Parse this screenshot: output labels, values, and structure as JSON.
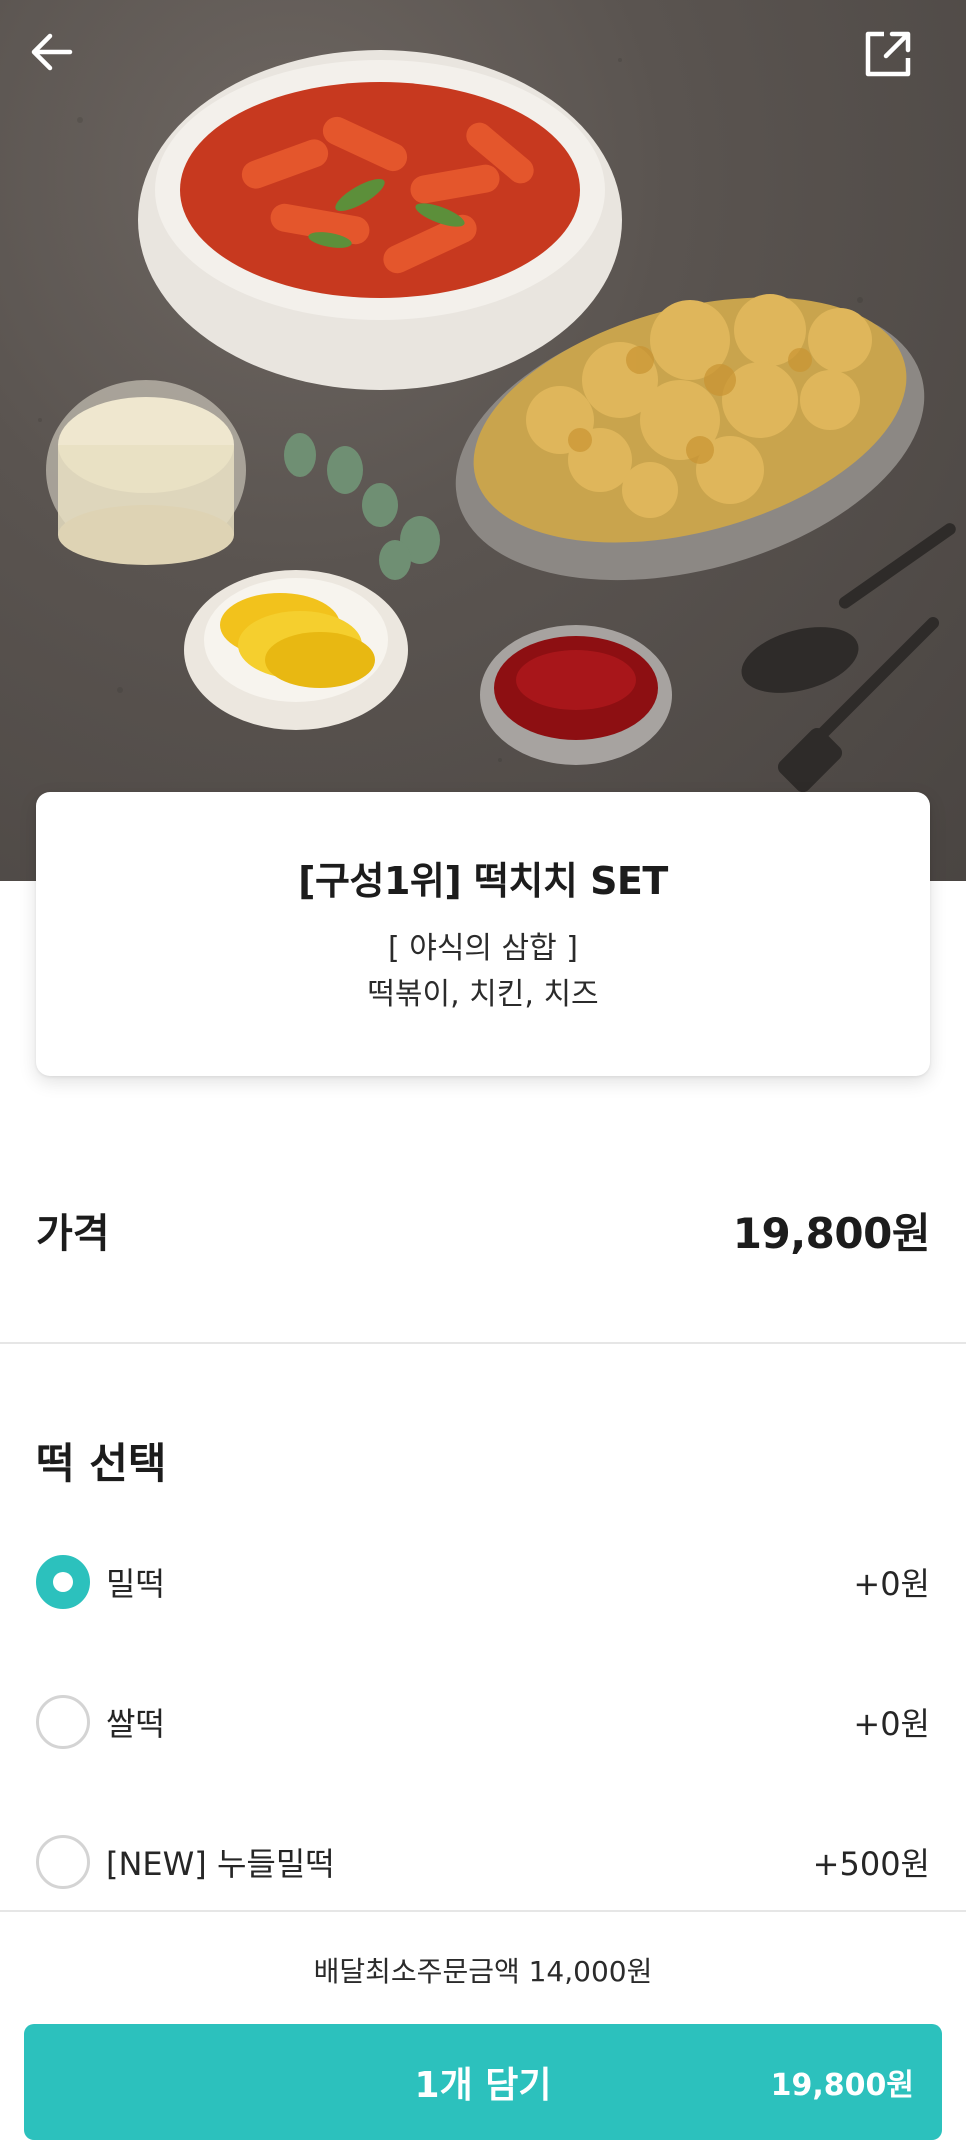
{
  "header": {
    "back_icon": "arrow-left-icon",
    "share_icon": "share-external-icon"
  },
  "product": {
    "title": "[구성1위] 떡치치 SET",
    "desc_line1": "[ 야식의 삼합 ]",
    "desc_line2": "떡볶이, 치킨, 치즈"
  },
  "price": {
    "label": "가격",
    "value": "19,800원"
  },
  "rice_cake_section": {
    "title": "떡 선택",
    "options": [
      {
        "label": "밀떡",
        "price": "+0원",
        "selected": true
      },
      {
        "label": "쌀떡",
        "price": "+0원",
        "selected": false
      },
      {
        "label": "[NEW] 누들밀떡",
        "price": "+500원",
        "selected": false
      }
    ]
  },
  "footer": {
    "min_order": "배달최소주문금액 14,000원",
    "cart_button_label": "1개 담기",
    "cart_button_price": "19,800원"
  },
  "colors": {
    "accent": "#2cc1bd"
  }
}
